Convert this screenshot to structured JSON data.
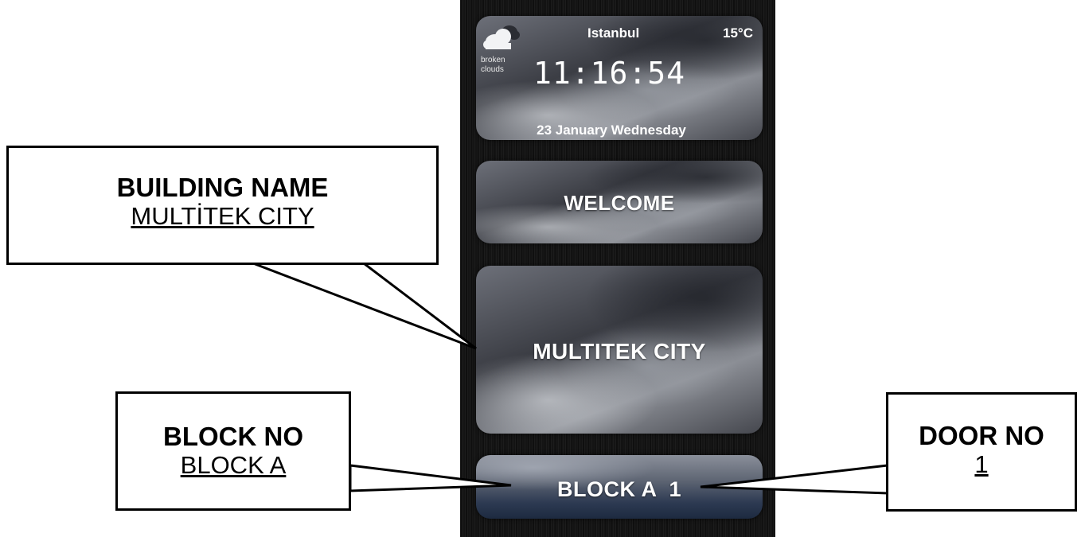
{
  "weather": {
    "icon": "broken-clouds-icon",
    "description_line1": "broken",
    "description_line2": "clouds",
    "city": "Istanbul",
    "temperature": "15°C",
    "time": "11:16:54",
    "date": "23 January Wednesday"
  },
  "welcome": {
    "text": "WELCOME"
  },
  "building": {
    "name": "MULTITEK CITY"
  },
  "block_bar": {
    "text": "BLOCK A  1"
  },
  "callouts": {
    "building_name": {
      "heading": "BUILDING NAME",
      "value": "MULTİTEK CITY"
    },
    "block_no": {
      "heading": "BLOCK NO",
      "value": "BLOCK A"
    },
    "door_no": {
      "heading": "DOOR NO",
      "value": "1"
    }
  }
}
